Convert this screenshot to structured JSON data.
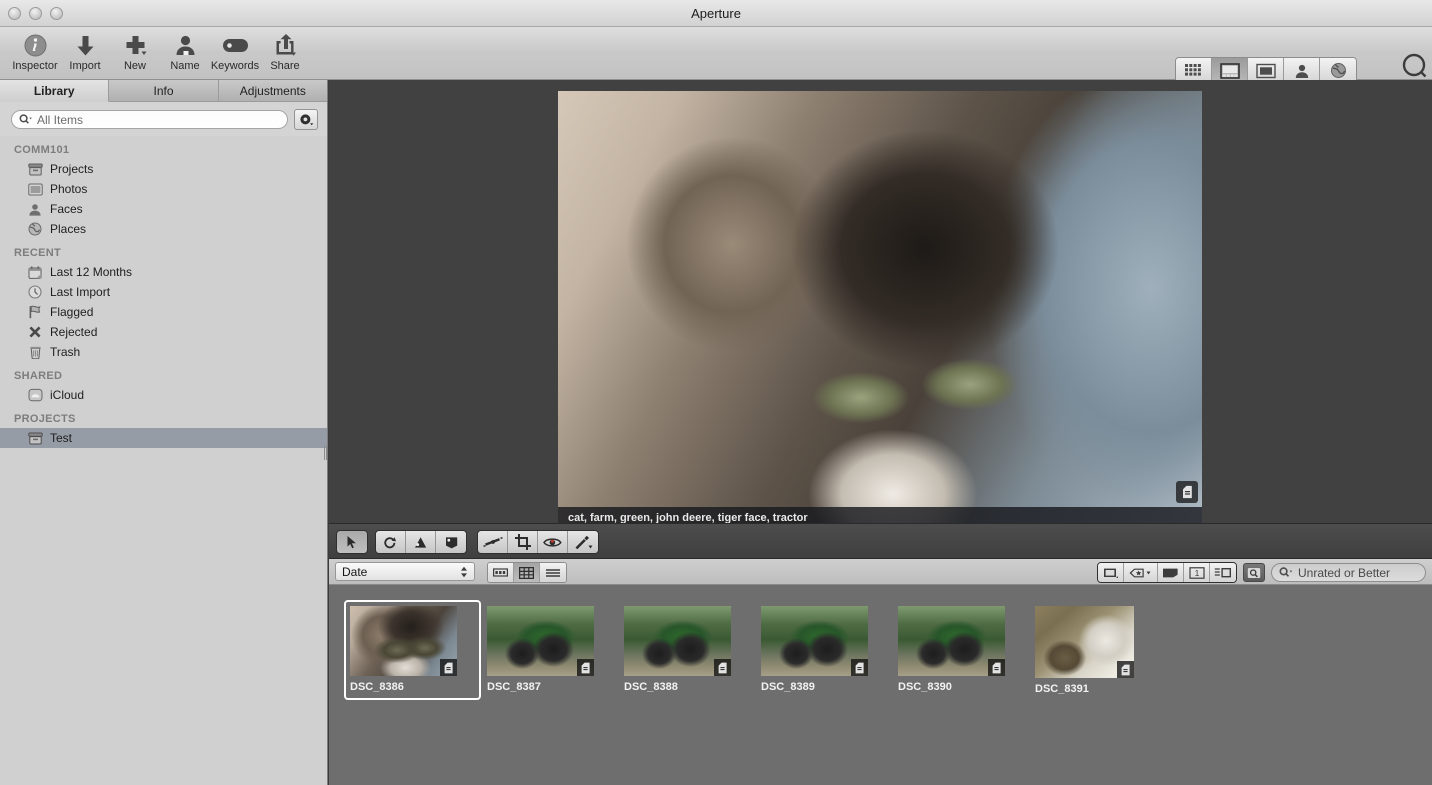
{
  "window": {
    "title": "Aperture",
    "traffic_lights": [
      "close",
      "minimize",
      "zoom"
    ]
  },
  "toolbar": {
    "items": [
      {
        "label": "Inspector",
        "icon": "info-circle-icon"
      },
      {
        "label": "Import",
        "icon": "download-arrow-icon"
      },
      {
        "label": "New",
        "icon": "plus-icon"
      },
      {
        "label": "Name",
        "icon": "person-icon"
      },
      {
        "label": "Keywords",
        "icon": "tag-icon"
      },
      {
        "label": "Share",
        "icon": "share-arrow-icon"
      }
    ],
    "view_modes": [
      {
        "name": "grid-view",
        "icon": "grid-icon",
        "selected": false
      },
      {
        "name": "split-view",
        "icon": "split-icon",
        "selected": true
      },
      {
        "name": "viewer-view",
        "icon": "viewer-icon",
        "selected": false
      },
      {
        "name": "faces-view",
        "icon": "person-icon",
        "selected": false
      },
      {
        "name": "places-view",
        "icon": "globe-icon",
        "selected": false
      }
    ],
    "view_mode_label": "Split View",
    "loupe_label": "Loupe",
    "loupe_icon": "loupe-icon"
  },
  "sidebar": {
    "tabs": [
      {
        "label": "Library",
        "active": true
      },
      {
        "label": "Info",
        "active": false
      },
      {
        "label": "Adjustments",
        "active": false
      }
    ],
    "search": {
      "value": "All Items",
      "icon": "search-icon"
    },
    "gear_icon": "gear-icon",
    "groups": [
      {
        "title": "COMM101",
        "items": [
          {
            "label": "Projects",
            "icon": "projects-icon",
            "selected": false
          },
          {
            "label": "Photos",
            "icon": "photos-icon",
            "selected": false
          },
          {
            "label": "Faces",
            "icon": "faces-icon",
            "selected": false
          },
          {
            "label": "Places",
            "icon": "places-icon",
            "selected": false
          }
        ]
      },
      {
        "title": "RECENT",
        "items": [
          {
            "label": "Last 12 Months",
            "icon": "calendar-icon",
            "selected": false
          },
          {
            "label": "Last Import",
            "icon": "clock-icon",
            "selected": false
          },
          {
            "label": "Flagged",
            "icon": "flag-icon",
            "selected": false
          },
          {
            "label": "Rejected",
            "icon": "x-icon",
            "selected": false
          },
          {
            "label": "Trash",
            "icon": "trash-icon",
            "selected": false
          }
        ]
      },
      {
        "title": "SHARED",
        "items": [
          {
            "label": "iCloud",
            "icon": "icloud-icon",
            "selected": false
          }
        ]
      },
      {
        "title": "PROJECTS",
        "items": [
          {
            "label": "Test",
            "icon": "projects-icon",
            "selected": true
          }
        ]
      }
    ]
  },
  "viewer": {
    "keywords": "cat, farm, green, john deere, tiger face, tractor",
    "badge_icon": "keyword-badge-icon"
  },
  "tools": {
    "group_a": [
      {
        "name": "selection-tool",
        "icon": "arrow-cursor-icon",
        "selected": true
      }
    ],
    "group_b": [
      {
        "name": "rotate-left-tool",
        "icon": "rotate-left-icon",
        "selected": false
      },
      {
        "name": "lift-tool",
        "icon": "lift-icon",
        "selected": false
      },
      {
        "name": "stamp-tool",
        "icon": "stamp-icon",
        "selected": false
      }
    ],
    "group_c": [
      {
        "name": "straighten-tool",
        "icon": "straighten-icon",
        "selected": false
      },
      {
        "name": "crop-tool",
        "icon": "crop-icon",
        "selected": false
      },
      {
        "name": "red-eye-tool",
        "icon": "eye-icon",
        "selected": false
      },
      {
        "name": "retouch-tool",
        "icon": "brush-icon",
        "selected": false
      }
    ]
  },
  "filterbar": {
    "sort_value": "Date",
    "sort_icon": "stepper-icon",
    "view_modes": [
      {
        "name": "filmstrip-view",
        "icon": "filmstrip-icon",
        "selected": false
      },
      {
        "name": "grid-view",
        "icon": "grid-icon",
        "selected": true
      },
      {
        "name": "list-view",
        "icon": "list-icon",
        "selected": false
      }
    ],
    "right_buttons": [
      {
        "name": "slideshow-button",
        "icon": "slideshow-icon"
      },
      {
        "name": "keyword-menu-button",
        "icon": "keyword-star-icon"
      },
      {
        "name": "flag-button",
        "icon": "flag-filled-icon"
      },
      {
        "name": "page-count-button",
        "icon": "one-up-icon",
        "label": "1"
      },
      {
        "name": "metadata-button",
        "icon": "metadata-icon"
      }
    ],
    "filter_toggle_icon": "filter-icon",
    "filter_search": {
      "value": "Unrated or Better",
      "icon": "search-icon"
    }
  },
  "browser": {
    "thumbnails": [
      {
        "label": "DSC_8386",
        "kind": "cat",
        "selected": true,
        "badge": "keyword-badge-icon"
      },
      {
        "label": "DSC_8387",
        "kind": "tractor",
        "selected": false,
        "badge": "keyword-badge-icon"
      },
      {
        "label": "DSC_8388",
        "kind": "tractor",
        "selected": false,
        "badge": "keyword-badge-icon"
      },
      {
        "label": "DSC_8389",
        "kind": "tractor",
        "selected": false,
        "badge": "keyword-badge-icon"
      },
      {
        "label": "DSC_8390",
        "kind": "tractor",
        "selected": false,
        "badge": "keyword-badge-icon"
      },
      {
        "label": "DSC_8391",
        "kind": "white",
        "selected": false,
        "badge": "keyword-badge-icon"
      }
    ]
  },
  "colors": {
    "titlebar": "#dcdcdc",
    "toolbar": "#c9c9c9",
    "sidebar": "#d0d0d0",
    "selection": "#969ca6",
    "viewer_bg": "#414141",
    "browser_bg": "#6e6e6e",
    "toolstrip_bg": "#454545"
  }
}
